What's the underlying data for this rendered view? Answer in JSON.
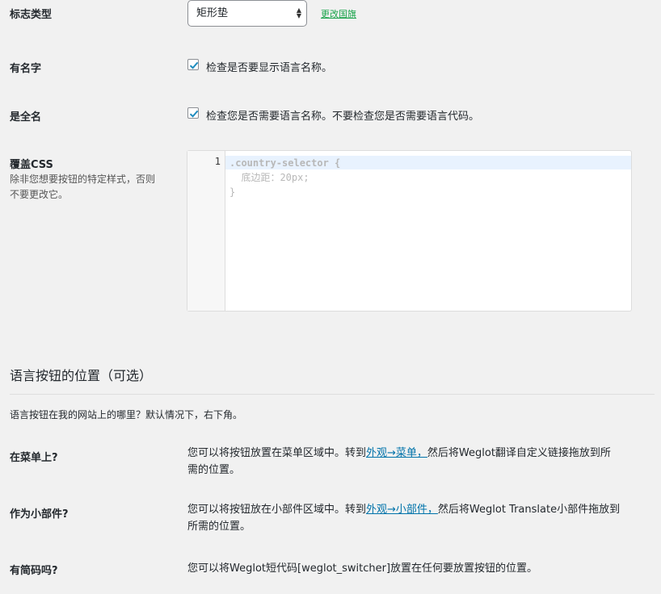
{
  "flag_type": {
    "label": "标志类型",
    "selected": "矩形垫",
    "change_link": "更改国旗"
  },
  "with_name": {
    "label": "有名字",
    "checked": true,
    "text": "检查是否要显示语言名称。"
  },
  "full_name": {
    "label": "是全名",
    "checked": true,
    "text": "检查您是否需要语言名称。不要检查您是否需要语言代码。"
  },
  "override_css": {
    "label": "覆盖CSS",
    "desc_line1": "除非您想要按钮的特定样式，否则",
    "desc_line2": "不要更改它。",
    "line_number": "1",
    "code_line1": ".country-selector {",
    "code_line2": "  底边距：20px;",
    "code_line3": "}"
  },
  "position_section": {
    "title": "语言按钮的位置（可选）",
    "intro": "语言按钮在我的网站上的哪里？默认情况下，右下角。",
    "in_menu": {
      "label": "在菜单上?",
      "text_before": "您可以将按钮放置在菜单区域中。转到",
      "link": "外观→菜单，",
      "text_after": "然后将Weglot翻译自定义链接拖放到所",
      "text_line2": "需的位置。"
    },
    "as_widget": {
      "label": "作为小部件?",
      "text_before": "您可以将按钮放在小部件区域中。转到",
      "link": "外观→小部件，",
      "text_after": "然后将Weglot Translate小部件拖放到",
      "text_line2": "所需的位置。"
    },
    "shortcode": {
      "label": "有简码吗?",
      "text": "您可以将Weglot短代码[weglot_switcher]放置在任何要放置按钮的位置。"
    }
  },
  "colors": {
    "accent_link": "#0073aa",
    "green_link": "#19a34a",
    "checkbox_check": "#1e8cbe"
  }
}
